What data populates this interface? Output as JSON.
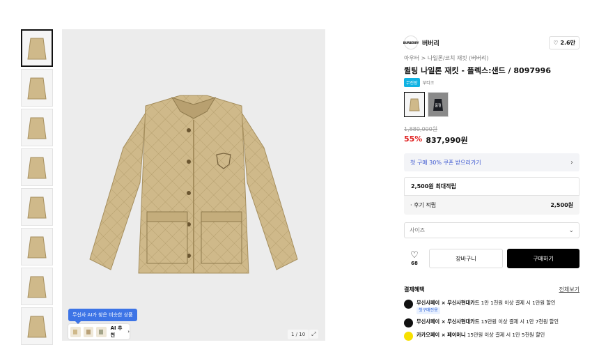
{
  "gallery": {
    "ai_tip": "무신사 AI가 찾은 비슷한 상품",
    "ai_label": "AI 추천",
    "counter": "1 / 10",
    "thumb_count": 8
  },
  "product": {
    "brand": "버버리",
    "brand_logo": "BURBERRY",
    "likes": "2.6만",
    "breadcrumb": "아우터 > 나일론/코치 재킷 (버버리)",
    "title": "퀼팅 나일론 재킷 - 플렉스:샌드 / 8097996",
    "badges": [
      "무진장",
      "부티크"
    ],
    "soldout_label": "품절",
    "original_price": "1,880,000원",
    "discount": "55%",
    "price": "837,990원",
    "jacket_color": "#cfb98a"
  },
  "coupon": {
    "text": "첫 구매 30% 쿠폰 받으러가기"
  },
  "points": {
    "title": "2,500원 최대적립",
    "row_label": "· 후기 적립",
    "row_value": "2,500원"
  },
  "size": {
    "placeholder": "사이즈"
  },
  "actions": {
    "wish_count": "68",
    "cart": "장바구니",
    "buy": "구매하기"
  },
  "payment": {
    "title": "결제혜택",
    "more": "전체보기",
    "items": [
      {
        "name": "무신사페이 × 무신사현대카드",
        "desc": " 1만 1천원 이상 결제 시 1만원 할인",
        "tag": "첫구매전용"
      },
      {
        "name": "무신사페이 × 무신사현대카드",
        "desc": " 15만원 이상 결제 시 1만 7천원 할인",
        "tag": ""
      },
      {
        "name": "카카오페이 × 페이머니",
        "desc": " 15만원 이상 결제 시 1만 5천원 할인",
        "tag": ""
      }
    ]
  }
}
